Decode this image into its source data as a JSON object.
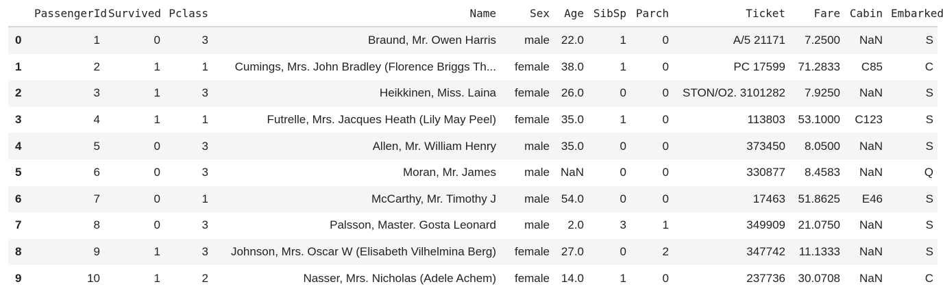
{
  "table": {
    "index_header": "",
    "columns": [
      "PassengerId",
      "Survived",
      "Pclass",
      "Name",
      "Sex",
      "Age",
      "SibSp",
      "Parch",
      "Ticket",
      "Fare",
      "Cabin",
      "Embarked"
    ],
    "rows": [
      {
        "index": "0",
        "cells": [
          "1",
          "0",
          "3",
          "Braund, Mr. Owen Harris",
          "male",
          "22.0",
          "1",
          "0",
          "A/5 21171",
          "7.2500",
          "NaN",
          "S"
        ]
      },
      {
        "index": "1",
        "cells": [
          "2",
          "1",
          "1",
          "Cumings, Mrs. John Bradley (Florence Briggs Th...",
          "female",
          "38.0",
          "1",
          "0",
          "PC 17599",
          "71.2833",
          "C85",
          "C"
        ]
      },
      {
        "index": "2",
        "cells": [
          "3",
          "1",
          "3",
          "Heikkinen, Miss. Laina",
          "female",
          "26.0",
          "0",
          "0",
          "STON/O2. 3101282",
          "7.9250",
          "NaN",
          "S"
        ]
      },
      {
        "index": "3",
        "cells": [
          "4",
          "1",
          "1",
          "Futrelle, Mrs. Jacques Heath (Lily May Peel)",
          "female",
          "35.0",
          "1",
          "0",
          "113803",
          "53.1000",
          "C123",
          "S"
        ]
      },
      {
        "index": "4",
        "cells": [
          "5",
          "0",
          "3",
          "Allen, Mr. William Henry",
          "male",
          "35.0",
          "0",
          "0",
          "373450",
          "8.0500",
          "NaN",
          "S"
        ]
      },
      {
        "index": "5",
        "cells": [
          "6",
          "0",
          "3",
          "Moran, Mr. James",
          "male",
          "NaN",
          "0",
          "0",
          "330877",
          "8.4583",
          "NaN",
          "Q"
        ]
      },
      {
        "index": "6",
        "cells": [
          "7",
          "0",
          "1",
          "McCarthy, Mr. Timothy J",
          "male",
          "54.0",
          "0",
          "0",
          "17463",
          "51.8625",
          "E46",
          "S"
        ]
      },
      {
        "index": "7",
        "cells": [
          "8",
          "0",
          "3",
          "Palsson, Master. Gosta Leonard",
          "male",
          "2.0",
          "3",
          "1",
          "349909",
          "21.0750",
          "NaN",
          "S"
        ]
      },
      {
        "index": "8",
        "cells": [
          "9",
          "1",
          "3",
          "Johnson, Mrs. Oscar W (Elisabeth Vilhelmina Berg)",
          "female",
          "27.0",
          "0",
          "2",
          "347742",
          "11.1333",
          "NaN",
          "S"
        ]
      },
      {
        "index": "9",
        "cells": [
          "10",
          "1",
          "2",
          "Nasser, Mrs. Nicholas (Adele Achem)",
          "female",
          "14.0",
          "1",
          "0",
          "237736",
          "30.0708",
          "NaN",
          "C"
        ]
      }
    ]
  },
  "colors": {
    "stripe": "#f5f5f5",
    "header_border": "#d6d6d6",
    "text": "#222222"
  }
}
